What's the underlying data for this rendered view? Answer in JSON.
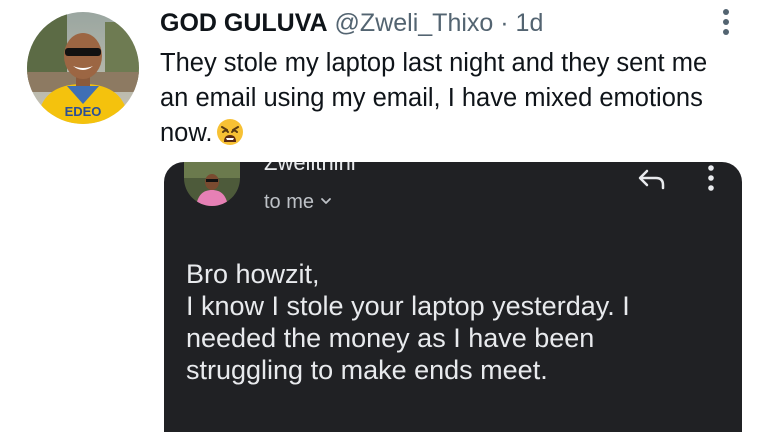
{
  "tweet": {
    "author_name": "GOD GULUVA",
    "author_handle": "@Zweli_Thixo",
    "separator": "·",
    "time": "1d",
    "text": "They stole my laptop last night and they sent me an email using my email, I have mixed emotions now.",
    "emoji_icon": "weary-face-icon",
    "avatar_sweater_text": "EDEO"
  },
  "email": {
    "sender_name": "Zwelithini",
    "recipient_label": "to me",
    "body_lines": [
      "Bro howzit,",
      "I know I stole your laptop yesterday. I",
      "needed the money as I have been",
      "struggling to make ends meet."
    ],
    "colors": {
      "background": "#202124",
      "text": "#e8eaed"
    }
  },
  "colors": {
    "text_primary": "#0f1419",
    "text_secondary": "#536471",
    "avatar_shirt": "#f4c20d"
  }
}
